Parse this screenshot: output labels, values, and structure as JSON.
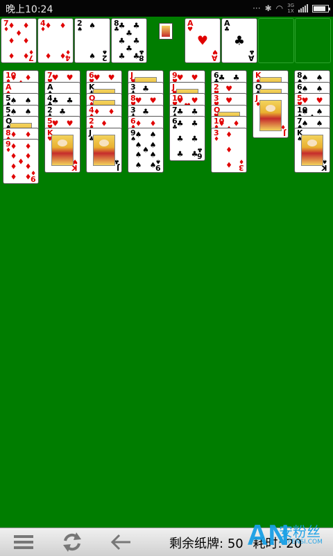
{
  "status_bar": {
    "time": "晚上10:24",
    "net_top": "3G",
    "net_bottom": "1X",
    "battery_level": 0.85
  },
  "colors": {
    "felt": "#007d00",
    "red_suit": "#e00000",
    "black_suit": "#000000",
    "slot_border": "#2da32d"
  },
  "free_cells": [
    {
      "rank": "7",
      "suit": "♦",
      "color": "red"
    },
    {
      "rank": "4",
      "suit": "♦",
      "color": "red"
    },
    {
      "rank": "2",
      "suit": "♠",
      "color": "black"
    },
    {
      "rank": "8",
      "suit": "♣",
      "color": "black"
    }
  ],
  "foundations": [
    {
      "rank": "A",
      "suit": "♥",
      "color": "red"
    },
    {
      "rank": "A",
      "suit": "♣",
      "color": "black"
    },
    null,
    null
  ],
  "tableau": [
    [
      {
        "rank": "10",
        "suit": "♦",
        "color": "red"
      },
      {
        "rank": "A",
        "suit": "♦",
        "color": "red"
      },
      {
        "rank": "5",
        "suit": "♠",
        "color": "black"
      },
      {
        "rank": "5",
        "suit": "♠",
        "color": "black"
      },
      {
        "rank": "Q",
        "suit": "♠",
        "color": "black"
      },
      {
        "rank": "8",
        "suit": "♦",
        "color": "red"
      },
      {
        "rank": "9",
        "suit": "♦",
        "color": "red"
      }
    ],
    [
      {
        "rank": "7",
        "suit": "♥",
        "color": "red"
      },
      {
        "rank": "A",
        "suit": "♠",
        "color": "black"
      },
      {
        "rank": "4",
        "suit": "♣",
        "color": "black"
      },
      {
        "rank": "2",
        "suit": "♣",
        "color": "black"
      },
      {
        "rank": "5",
        "suit": "♥",
        "color": "red"
      },
      {
        "rank": "K",
        "suit": "♥",
        "color": "red",
        "face": true
      }
    ],
    [
      {
        "rank": "6",
        "suit": "♥",
        "color": "red"
      },
      {
        "rank": "K",
        "suit": "♣",
        "color": "black"
      },
      {
        "rank": "Q",
        "suit": "♦",
        "color": "red"
      },
      {
        "rank": "4",
        "suit": "♦",
        "color": "red"
      },
      {
        "rank": "2",
        "suit": "♦",
        "color": "red"
      },
      {
        "rank": "J",
        "suit": "♣",
        "color": "black",
        "face": true
      }
    ],
    [
      {
        "rank": "J",
        "suit": "♥",
        "color": "red"
      },
      {
        "rank": "3",
        "suit": "♣",
        "color": "black"
      },
      {
        "rank": "8",
        "suit": "♥",
        "color": "red"
      },
      {
        "rank": "3",
        "suit": "♣",
        "color": "black"
      },
      {
        "rank": "6",
        "suit": "♦",
        "color": "red"
      },
      {
        "rank": "9",
        "suit": "♠",
        "color": "black"
      }
    ],
    [
      {
        "rank": "9",
        "suit": "♥",
        "color": "red"
      },
      {
        "rank": "J",
        "suit": "♥",
        "color": "red"
      },
      {
        "rank": "10",
        "suit": "♥",
        "color": "red"
      },
      {
        "rank": "7",
        "suit": "♣",
        "color": "black"
      },
      {
        "rank": "6",
        "suit": "♣",
        "color": "black"
      }
    ],
    [
      {
        "rank": "6",
        "suit": "♣",
        "color": "black"
      },
      {
        "rank": "2",
        "suit": "♥",
        "color": "red"
      },
      {
        "rank": "3",
        "suit": "♥",
        "color": "red"
      },
      {
        "rank": "Q",
        "suit": "♥",
        "color": "red"
      },
      {
        "rank": "10",
        "suit": "♦",
        "color": "red"
      },
      {
        "rank": "3",
        "suit": "♦",
        "color": "red"
      }
    ],
    [
      {
        "rank": "K",
        "suit": "♦",
        "color": "red"
      },
      {
        "rank": "Q",
        "suit": "♣",
        "color": "black"
      },
      {
        "rank": "J",
        "suit": "♦",
        "color": "red",
        "face": true
      }
    ],
    [
      {
        "rank": "8",
        "suit": "♠",
        "color": "black"
      },
      {
        "rank": "6",
        "suit": "♠",
        "color": "black"
      },
      {
        "rank": "5",
        "suit": "♥",
        "color": "red"
      },
      {
        "rank": "10",
        "suit": "♠",
        "color": "black"
      },
      {
        "rank": "7",
        "suit": "♠",
        "color": "black"
      },
      {
        "rank": "K",
        "suit": "♠",
        "color": "black",
        "face": true
      }
    ]
  ],
  "bottom_bar": {
    "icons": {
      "menu": "menu-icon",
      "refresh": "refresh-icon",
      "back": "back-arrow-icon"
    },
    "remaining_label": "剩余纸牌:",
    "remaining_value": "50",
    "time_label": "耗时:",
    "time_value": "20"
  },
  "watermark": {
    "logo": "AN",
    "text": "安粉丝",
    "url": "ANFENSI.COM"
  }
}
